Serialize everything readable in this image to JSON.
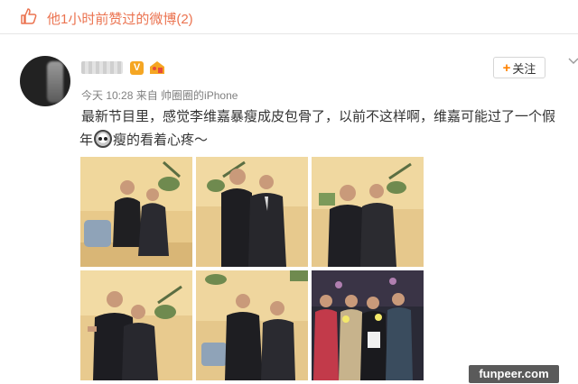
{
  "likes_bar": {
    "text": "他1小时前赞过的微博(2)",
    "icon": "thumb-up-icon"
  },
  "post": {
    "follow_label": "关注",
    "time": "今天 10:28",
    "source": "来自 帅圈圈的iPhone",
    "text_line1": "最新节目里，感觉李维嘉暴瘦成皮包骨了，以前不这样啊，维嘉可能过了一个假",
    "text_line2_a": "年",
    "text_line2_b": "瘦的看着心疼～"
  },
  "watermark": "funpeer.com",
  "colors": {
    "accent": "#eb7350",
    "follow_plus": "#ff8200",
    "badge": "#f5a623"
  }
}
